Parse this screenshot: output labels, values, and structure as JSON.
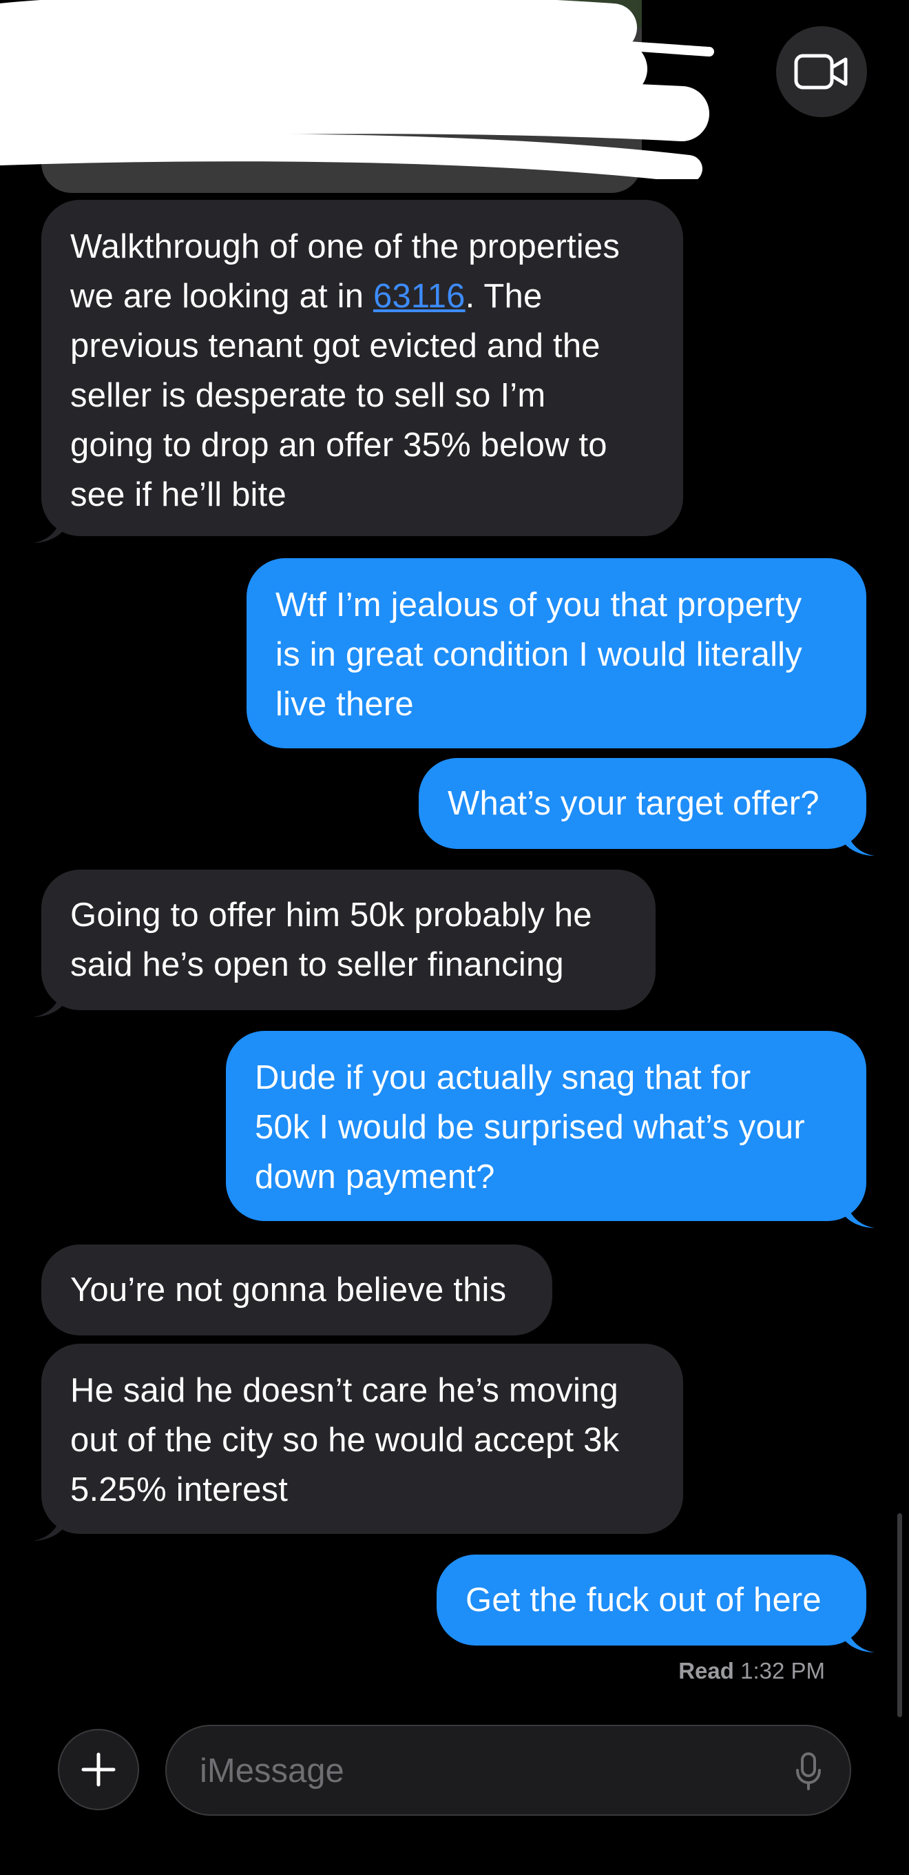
{
  "header": {
    "video_icon": "video-camera-icon"
  },
  "messages": [
    {
      "direction": "incoming",
      "text_before": "Walkthrough of one of the properties\nwe are looking at in ",
      "link": "63116",
      "text_after": ". The\nprevious tenant got evicted and the\nseller is desperate to sell so I’m\ngoing to drop an offer 35% below to\nsee if he’ll bite"
    },
    {
      "direction": "outgoing",
      "text": "Wtf I’m jealous of you that property\nis in great condition I would literally\nlive there"
    },
    {
      "direction": "outgoing",
      "text": "What’s your target offer?"
    },
    {
      "direction": "incoming",
      "text": "Going to offer him 50k probably he\nsaid he’s open to seller financing"
    },
    {
      "direction": "outgoing",
      "text": "Dude if you actually snag that for\n50k I would be surprised what’s your\ndown payment?"
    },
    {
      "direction": "incoming",
      "text": "You’re not gonna believe this"
    },
    {
      "direction": "incoming",
      "text": "He said he doesn’t care he’s moving\nout of the city so he would accept 3k\n5.25% interest"
    },
    {
      "direction": "outgoing",
      "text": "Get the fuck out of here"
    }
  ],
  "read_receipt": {
    "label": "Read",
    "time": "1:32 PM"
  },
  "compose": {
    "placeholder": "iMessage",
    "plus_icon": "plus-icon",
    "mic_icon": "microphone-icon"
  },
  "colors": {
    "background": "#000000",
    "incoming_bubble": "#26262a",
    "outgoing_bubble": "#1e8ef9",
    "link": "#3d8cff"
  }
}
